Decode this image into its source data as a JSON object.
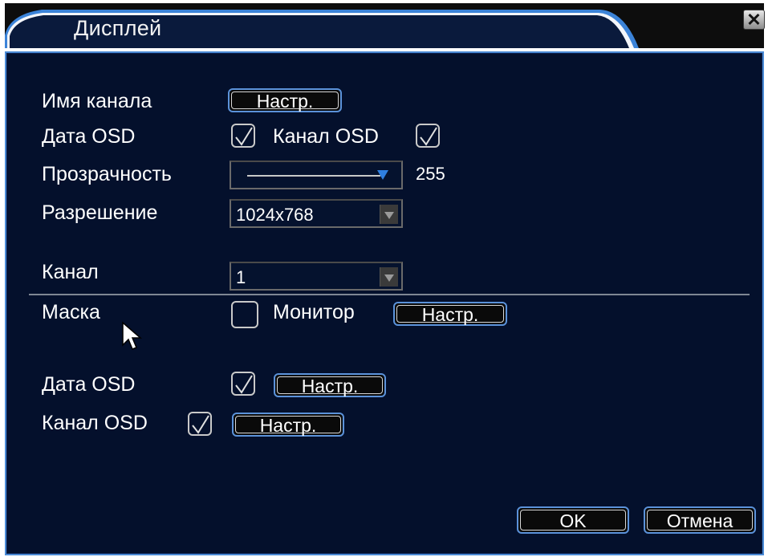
{
  "dialog": {
    "title": "Дисплей",
    "close_glyph": "✕"
  },
  "general": {
    "channel_name_label": "Имя канала",
    "channel_name_button": "Настр.",
    "date_osd_label": "Дата OSD",
    "date_osd_checked": true,
    "channel_osd_label": "Канал OSD",
    "channel_osd_checked": true,
    "transparency_label": "Прозрачность",
    "transparency_value": "255",
    "transparency_level": 1.0,
    "resolution_label": "Разрешение",
    "resolution_value": "1024x768"
  },
  "channel_settings": {
    "channel_label": "Канал",
    "channel_value": "1",
    "mask_label": "Маска",
    "mask_checked": false,
    "monitor_label": "Монитор",
    "monitor_button": "Настр.",
    "date_osd_label": "Дата OSD",
    "date_osd_checked": true,
    "date_osd_button": "Настр.",
    "channel_osd_label": "Канал OSD",
    "channel_osd_checked": true,
    "channel_osd_button": "Настр."
  },
  "footer": {
    "ok_label": "OK",
    "cancel_label": "Отмена"
  },
  "colors": {
    "panel_bg": "#04102c",
    "border_blue": "#4b8bd6",
    "slider_thumb": "#2f7fe0"
  },
  "icons": [
    "close-icon",
    "checkmark-icon",
    "dropdown-arrow-icon",
    "slider-thumb-icon",
    "mouse-cursor-icon"
  ]
}
